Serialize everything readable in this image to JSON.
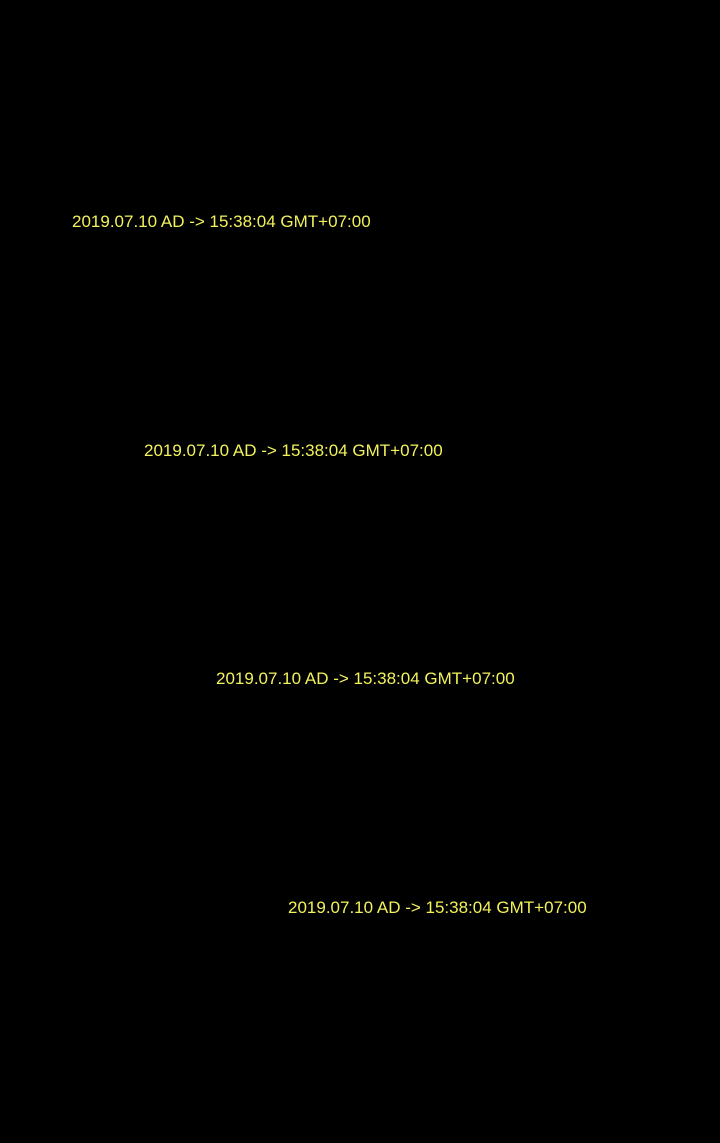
{
  "text_color": "#f2f25c",
  "background_color": "#000000",
  "clock_lines": [
    "2019.07.10 AD -> 15:38:04 GMT+07:00",
    "2019.07.10 AD -> 15:38:04 GMT+07:00",
    "2019.07.10 AD -> 15:38:04 GMT+07:00",
    "2019.07.10 AD -> 15:38:04 GMT+07:00"
  ]
}
